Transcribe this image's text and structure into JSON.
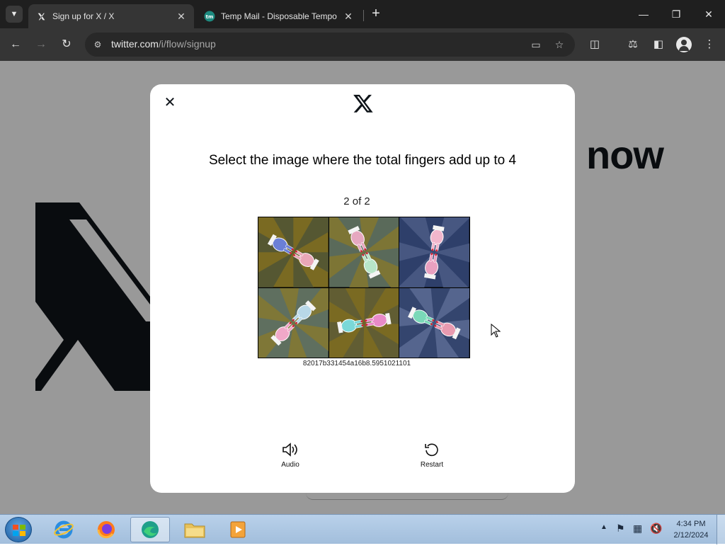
{
  "browser": {
    "tabs": [
      {
        "title": "Sign up for X / X",
        "favicon": "x-logo-icon",
        "active": true
      },
      {
        "title": "Temp Mail - Disposable Tempo",
        "favicon": "tempmail-icon",
        "active": false
      }
    ],
    "url_domain": "twitter.com",
    "url_path": "/i/flow/signup"
  },
  "background_page": {
    "headline_fragment": "now"
  },
  "captcha": {
    "prompt": "Select the image where the total fingers add up to 4",
    "counter": "2 of 2",
    "session_id": "82017b331454a16b8.5951021101",
    "audio_label": "Audio",
    "restart_label": "Restart",
    "tiles": [
      {
        "bg": "#7a6a22",
        "ray": "#4a5238",
        "hands": [
          "#6b7fd6",
          "#e9a7b8"
        ]
      },
      {
        "bg": "#5a6a5a",
        "ray": "#8a7a2a",
        "hands": [
          "#e6a8c0",
          "#b8e6c8"
        ]
      },
      {
        "bg": "#2e3f6a",
        "ray": "#50608a",
        "hands": [
          "#f2b6cc",
          "#e8a0c0"
        ]
      },
      {
        "bg": "#5f6f5f",
        "ray": "#8a7a2a",
        "hands": [
          "#b8d8e8",
          "#f0a8c8"
        ]
      },
      {
        "bg": "#7a6a22",
        "ray": "#5a5a3a",
        "hands": [
          "#e88ac8",
          "#7ad8d8"
        ]
      },
      {
        "bg": "#34456e",
        "ray": "#60709a",
        "hands": [
          "#e89ab0",
          "#7ad8b8"
        ]
      }
    ]
  },
  "taskbar": {
    "time": "4:34 PM",
    "date": "2/12/2024"
  }
}
